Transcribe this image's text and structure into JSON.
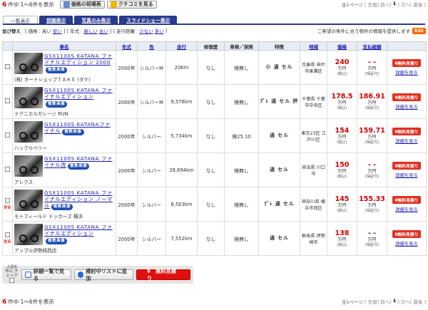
{
  "header": {
    "count_num": "6",
    "count_text": "件中 1～6件を表示",
    "btn_market": "価格の相場表",
    "btn_review": "クチコミを見る",
    "page_total": "全1ページ",
    "first": "[ 先頭]",
    "prev": "前へ[",
    "cur_page": "1",
    "next": "] 次へ[",
    "last": "最後 ]"
  },
  "tabs": [
    "一覧表示",
    "詳細表示",
    "写真のみ表示",
    "スライドショー表示"
  ],
  "sortbar": {
    "label": "並び替え",
    "price": "[ 価格 :",
    "high": "高い",
    "low": "安い",
    "year": "] [ 年式 :",
    "new": "新しい",
    "old": "古い",
    "km": "] [ 走行距離 :",
    "few": "少ない",
    "many": "多い",
    "end": "]",
    "notice": "ご希望の条件に合う物件の情報を提供します",
    "rss": "RSS"
  },
  "columns": [
    "",
    "車名",
    "年式",
    "色",
    "走行",
    "修復歴",
    "車検／保険",
    "特徴",
    "地域",
    "価格",
    "支払総額",
    ""
  ],
  "labels": {
    "badge": "複数画像",
    "man": "万円",
    "tax": "(税込)",
    "tax_note": "(保証付)",
    "estimate": "¥無料見積り",
    "detail": "詳細を見る",
    "new_tag": "更新"
  },
  "rows": [
    {
      "title": "GSX1100S KATANA ファイナルエディション 2000",
      "shop": "(株) オートショップＴＡＫＥ (タケ)",
      "year": "2000年",
      "color": "シルバーM",
      "km": "20Km",
      "repair": "なし",
      "inspection": "検無し",
      "features": "小 通 セル",
      "region": "兵庫県 神戸市東灘区",
      "price": "240",
      "total": "- -",
      "new": false
    },
    {
      "title": "GSX1100S KATANA ファイナルエディション",
      "shop": "テクニカルガレージ RUN",
      "year": "2000年",
      "color": "シルバーM",
      "km": "9,578km",
      "repair": "なし",
      "inspection": "検無し",
      "features": "ｸﾞﾚ 通 セル 評",
      "region": "千葉県 千葉市中央区",
      "price": "178.5",
      "total": "186.91",
      "new": false
    },
    {
      "title": "GSX1100S KATANAファイナル",
      "shop": "ハックルベリー",
      "year": "2000年",
      "color": "シルバー",
      "km": "5,734km",
      "repair": "なし",
      "inspection": "検25.10",
      "features": "通 セル",
      "region": "東京23区 江戸川区",
      "price": "154",
      "total": "159.71",
      "new": false
    },
    {
      "title": "GSX1100S KATANA ファイナル改",
      "shop": "アレクス",
      "year": "2000年",
      "color": "シルバー",
      "km": "28,694km",
      "repair": "なし",
      "inspection": "検無し",
      "features": "通 セル",
      "region": "埼玉県 川口市",
      "price": "150",
      "total": "- -",
      "new": false
    },
    {
      "title": "GSX1100S KATANA ファイナルエディション ノーマル",
      "shop": "モトフィールド ドッカーズ 横浜",
      "year": "2000年",
      "color": "シルバー",
      "km": "8,503km",
      "repair": "なし",
      "inspection": "検無し",
      "features": "ｸﾞﾚ 通 セル",
      "region": "神奈川県 横浜市旭区",
      "price": "145",
      "total": "155.33",
      "new": true
    },
    {
      "title": "GSX1100S KATANA ファイナルエディション",
      "shop": "アップル伊勢崎西店",
      "year": "2000年",
      "color": "シルバー",
      "km": "7,552km",
      "repair": "なし",
      "inspection": "検無し",
      "features": "通 セル",
      "region": "群馬県 伊勢崎市",
      "price": "138",
      "total": "- -",
      "new": true
    }
  ],
  "bottom": {
    "check_label": "上記6件に チェック",
    "btn_detail": "詳細一覧で見る",
    "btn_list": "検討中リストに追加",
    "btn_estimate": "¥　無料見積り"
  }
}
